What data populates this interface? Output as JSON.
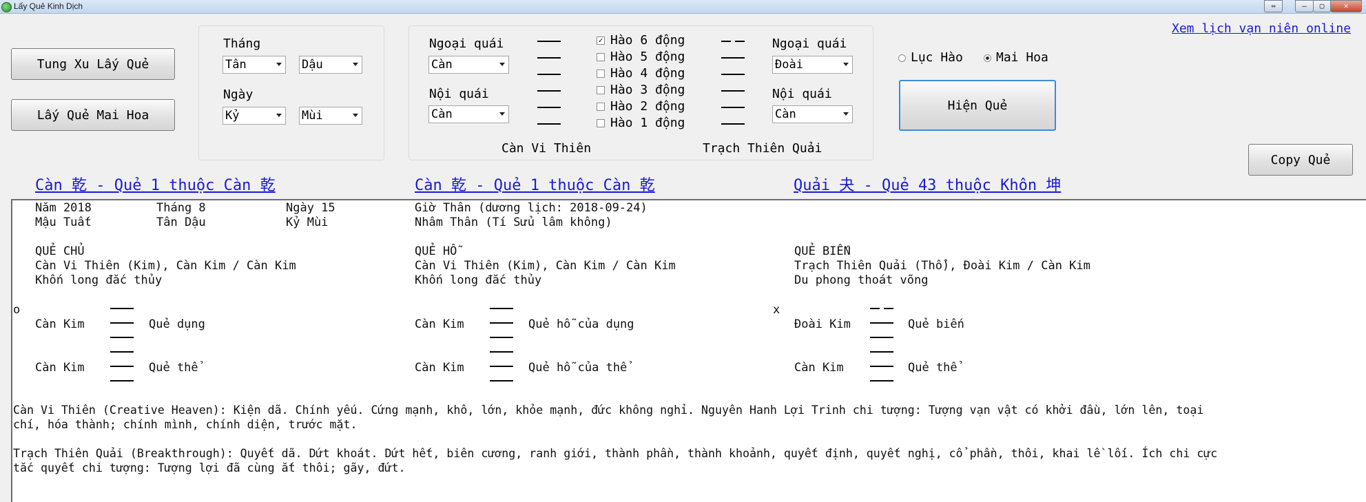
{
  "window": {
    "title": "Lấy Quẻ Kinh Dịch",
    "controls": [
      "⇔",
      "–",
      "▢",
      "✕"
    ]
  },
  "buttons": {
    "tung_xu": "Tung Xu Lấy Quẻ",
    "mai_hoa": "Lấy Quẻ Mai Hoa",
    "hien_que": "Hiện Quẻ",
    "copy_que": "Copy Quẻ"
  },
  "date_panel": {
    "thang_label": "Tháng",
    "thang_can": "Tân",
    "thang_chi": "Dậu",
    "ngay_label": "Ngày",
    "ngay_can": "Kỷ",
    "ngay_chi": "Mùi"
  },
  "trigram_panel": {
    "left": {
      "ngoai_label": "Ngoại quái",
      "ngoai_value": "Càn",
      "noi_label": "Nội quái",
      "noi_value": "Càn",
      "name": "Càn Vi Thiên"
    },
    "right": {
      "ngoai_label": "Ngoại quái",
      "ngoai_value": "Đoài",
      "noi_label": "Nội quái",
      "noi_value": "Càn",
      "name": "Trạch Thiên Quải"
    },
    "hao": [
      {
        "label": "Hào 6 động",
        "checked": true
      },
      {
        "label": "Hào 5 động",
        "checked": false
      },
      {
        "label": "Hào 4 động",
        "checked": false
      },
      {
        "label": "Hào 3 động",
        "checked": false
      },
      {
        "label": "Hào 2 động",
        "checked": false
      },
      {
        "label": "Hào 1 động",
        "checked": false
      }
    ],
    "left_lines": [
      "yang",
      "yang",
      "yang",
      "yang",
      "yang",
      "yang"
    ],
    "right_lines": [
      "yin",
      "yang",
      "yang",
      "yang",
      "yang",
      "yang"
    ]
  },
  "mode": {
    "luc_hao": "Lục Hào",
    "mai_hoa": "Mai Hoa",
    "selected": "Mai Hoa"
  },
  "calendar_link": "Xem lịch vạn niên online",
  "headings": {
    "chu": "Càn 乾 - Quẻ 1 thuộc Càn 乾",
    "ho": "Càn 乾 - Quẻ 1 thuộc Càn 乾",
    "bien": "Quải 夬 - Quẻ 43 thuộc Khôn 坤"
  },
  "output": {
    "nam": "Năm 2018",
    "thang": "Tháng 8",
    "ngay": "Ngày 15",
    "gio": "Giờ Thân (dương lịch: 2018-09-24)",
    "nam_can_chi": "Mậu Tuất",
    "thang_can_chi": "Tân Dậu",
    "ngay_can_chi": "Kỷ Mùi",
    "gio_can_chi": "Nhâm Thân (Tí Sửu lâm không)",
    "chu": {
      "title": "QUẺ CHỦ",
      "line1": "Càn Vi Thiên (Kim), Càn Kim / Càn Kim",
      "line2": "Khốn long đắc thủy",
      "upper": "Càn Kim",
      "upper_role": "Quẻ dụng",
      "lower": "Càn Kim",
      "lower_role": "Quẻ thể",
      "marker": "o"
    },
    "ho": {
      "title": "QUẺ HỖ",
      "line1": "Càn Vi Thiên (Kim), Càn Kim / Càn Kim",
      "line2": "Khốn long đắc thủy",
      "upper": "Càn Kim",
      "upper_role": "Quẻ hỗ của dụng",
      "lower": "Càn Kim",
      "lower_role": "Quẻ hỗ của thể"
    },
    "bien": {
      "title": "QUẺ BIẾN",
      "line1": "Trạch Thiên Quải (Thổ), Đoài Kim / Càn Kim",
      "line2": "Du phong thoát võng",
      "upper": "Đoài Kim",
      "upper_role": "Quẻ biến",
      "lower": "Càn Kim",
      "lower_role": "Quẻ thể",
      "marker": "x"
    },
    "desc1a": "Càn Vi Thiên (Creative Heaven): Kiện dã. Chính yếu. Cứng mạnh, khô, lớn, khỏe mạnh, đức không nghỉ. Nguyên Hanh Lợi Trinh chi tượng: Tượng vạn vật có khởi đầu, lớn lên, toại",
    "desc1b": "chí, hóa thành; chính mình, chính diện, trước mặt.",
    "desc2a": "Trạch Thiên Quải (Breakthrough): Quyết dã. Dứt khoát. Dứt hết, biên cương, ranh giới, thành phần, thành khoảnh, quyết định, quyết nghị, cổ phần, thôi, khai lề lối. Ích chi cực",
    "desc2b": "tắc quyết chi tượng: Tượng lợi đã cùng ắt thôi; gãy, đứt."
  }
}
